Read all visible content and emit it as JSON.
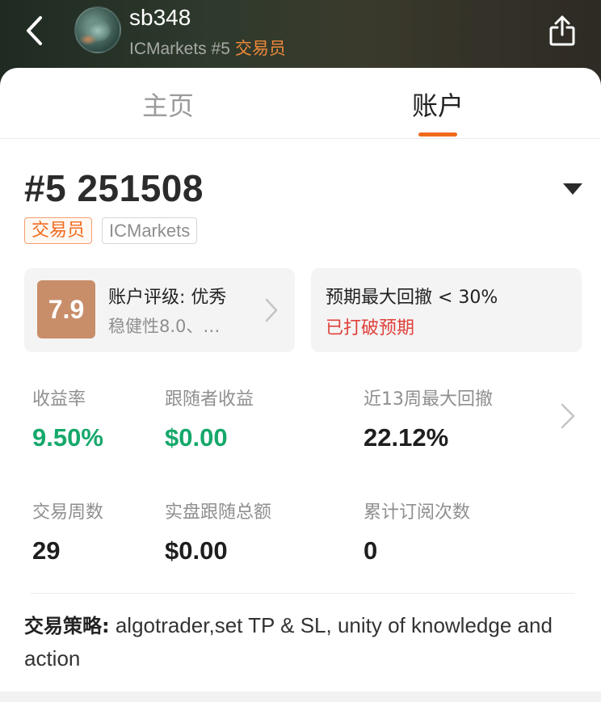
{
  "header": {
    "username": "sb348",
    "broker_rank": "ICMarkets #5",
    "role": "交易员"
  },
  "tabs": [
    {
      "label": "主页",
      "active": false
    },
    {
      "label": "账户",
      "active": true
    }
  ],
  "account": {
    "title": "#5 251508",
    "tags": [
      "交易员",
      "ICMarkets"
    ]
  },
  "rating_card": {
    "score": "7.9",
    "title": "账户评级: 优秀",
    "subtitle": "稳健性8.0、…"
  },
  "drawdown_card": {
    "title": "预期最大回撤 < 30%",
    "status": "已打破预期"
  },
  "stats": {
    "return_rate": {
      "label": "收益率",
      "value": "9.50%"
    },
    "follower_profit": {
      "label": "跟随者收益",
      "value": "$0.00"
    },
    "max_drawdown_13w": {
      "label": "近13周最大回撤",
      "value": "22.12%"
    },
    "trading_weeks": {
      "label": "交易周数",
      "value": "29"
    },
    "live_follow_total": {
      "label": "实盘跟随总额",
      "value": "$0.00"
    },
    "subscriptions": {
      "label": "累计订阅次数",
      "value": "0"
    }
  },
  "strategy": {
    "label": "交易策略:",
    "text": "algotrader,set TP & SL, unity of knowledge and action"
  },
  "colors": {
    "accent_orange": "#f06a1d",
    "positive_green": "#15a86b",
    "alert_red": "#e0413b",
    "score_badge": "#c88e6a"
  }
}
